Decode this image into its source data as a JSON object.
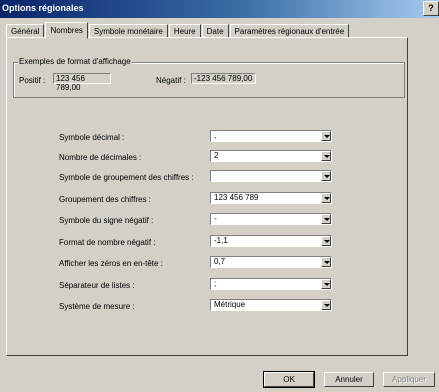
{
  "window": {
    "title": "Options régionales",
    "help_glyph": "?"
  },
  "tabs": [
    {
      "label": "Général",
      "active": false
    },
    {
      "label": "Nombres",
      "active": true
    },
    {
      "label": "Symbole monétaire",
      "active": false
    },
    {
      "label": "Heure",
      "active": false
    },
    {
      "label": "Date",
      "active": false
    },
    {
      "label": "Paramètres régionaux d'entrée",
      "active": false
    }
  ],
  "examples": {
    "legend": "Exemples de format d'affichage",
    "positive_label": "Positif :",
    "positive_value": "123 456 789,00",
    "negative_label": "Négatif :",
    "negative_value": "-123 456 789,00"
  },
  "settings": [
    {
      "label": "Symbole décimal :",
      "value": ","
    },
    {
      "label": "Nombre de décimales :",
      "value": "2"
    },
    {
      "label": "Symbole de groupement des chiffres :",
      "value": ""
    },
    {
      "label": "Groupement des chiffres :",
      "value": "123 456 789"
    },
    {
      "label": "Symbole du signe négatif :",
      "value": "-"
    },
    {
      "label": "Format de nombre négatif :",
      "value": "-1,1"
    },
    {
      "label": "Afficher les zéros en en-tête :",
      "value": "0,7"
    },
    {
      "label": "Séparateur de listes :",
      "value": ";"
    },
    {
      "label": "Système de mesure :",
      "value": "Métrique"
    }
  ],
  "buttons": {
    "ok": "OK",
    "cancel": "Annuler",
    "apply": "Appliquer"
  }
}
